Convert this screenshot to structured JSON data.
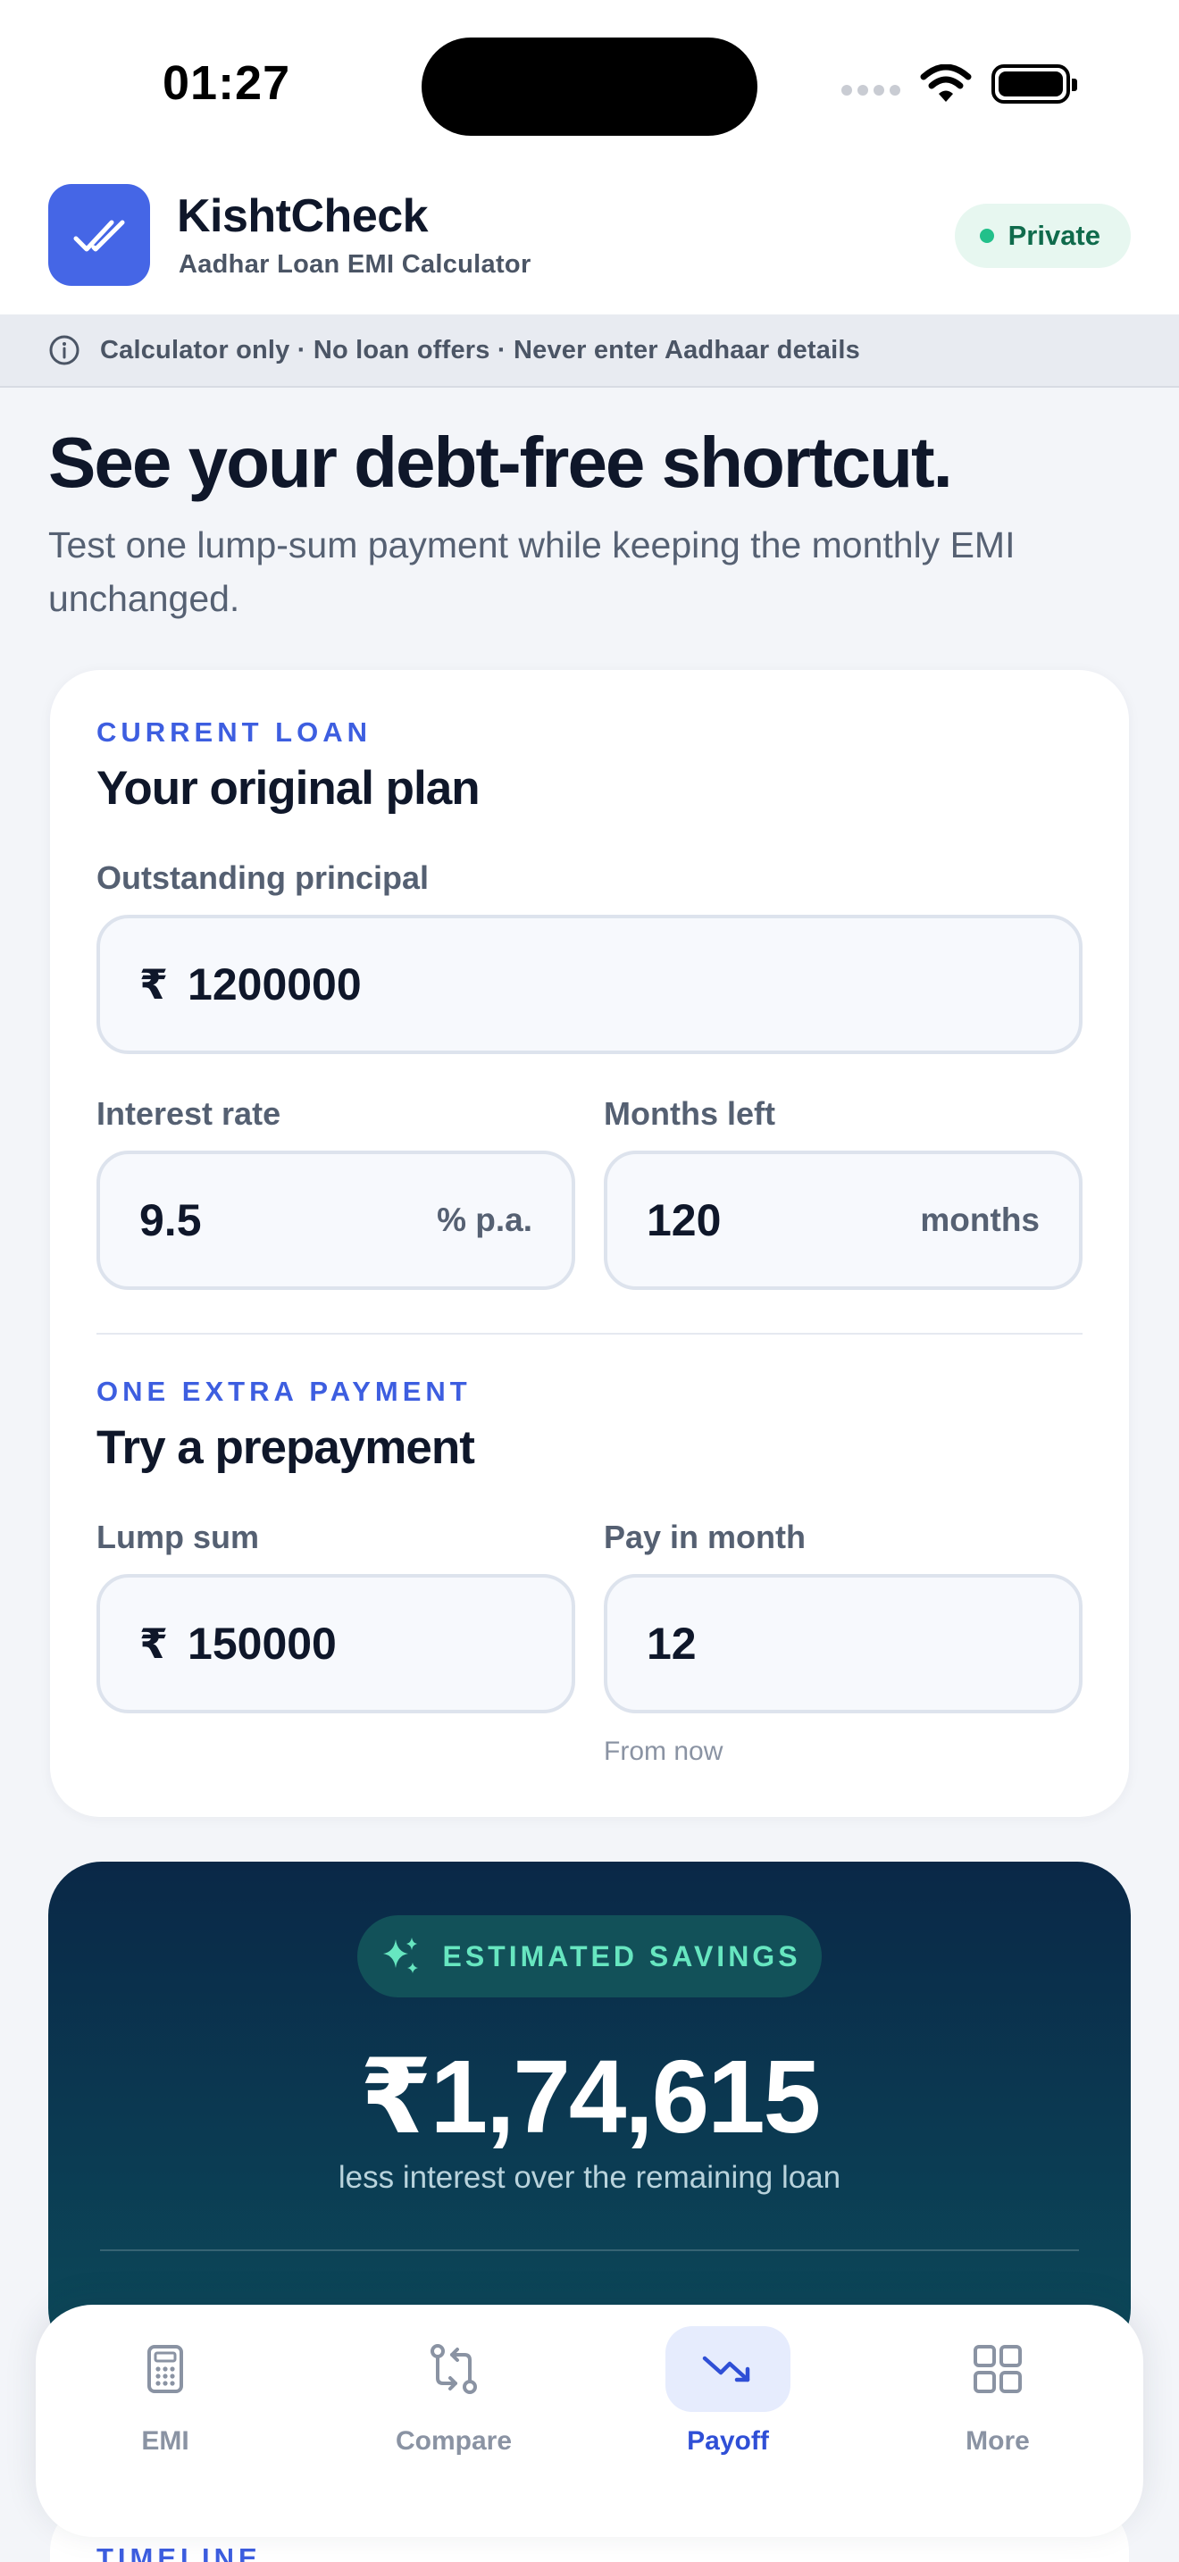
{
  "status_bar": {
    "time": "01:27"
  },
  "header": {
    "app_name": "KishtCheck",
    "app_subtitle": "Aadhar Loan EMI Calculator",
    "badge": "Private",
    "logo_icon": "double-check-icon",
    "accent_color": "#4566e6"
  },
  "disclaimer": {
    "icon": "info-icon",
    "text": "Calculator only · No loan offers · Never enter Aadhaar details"
  },
  "hero": {
    "title": "See your debt-free shortcut.",
    "subtitle": "Test one lump-sum payment while keeping the monthly EMI unchanged."
  },
  "loan_card": {
    "eyebrow": "CURRENT LOAN",
    "title": "Your original plan",
    "principal": {
      "label": "Outstanding principal",
      "prefix": "₹",
      "value": "1200000"
    },
    "rate": {
      "label": "Interest rate",
      "value": "9.5",
      "suffix": "% p.a."
    },
    "months": {
      "label": "Months left",
      "value": "120",
      "suffix": "months"
    }
  },
  "prepay_card": {
    "eyebrow": "ONE EXTRA PAYMENT",
    "title": "Try a prepayment",
    "lump_sum": {
      "label": "Lump sum",
      "prefix": "₹",
      "value": "150000"
    },
    "pay_month": {
      "label": "Pay in month",
      "value": "12",
      "helper": "From now"
    }
  },
  "savings": {
    "pill": "ESTIMATED SAVINGS",
    "pill_icon": "sparkles-icon",
    "amount": "₹1,74,615",
    "description": "less interest over the remaining loan"
  },
  "timeline": {
    "eyebrow": "TIMELINE"
  },
  "nav": {
    "items": [
      {
        "label": "EMI",
        "icon": "calculator-icon"
      },
      {
        "label": "Compare",
        "icon": "compare-arrows-icon"
      },
      {
        "label": "Payoff",
        "icon": "trend-down-icon",
        "active": true
      },
      {
        "label": "More",
        "icon": "grid-icon"
      }
    ]
  }
}
